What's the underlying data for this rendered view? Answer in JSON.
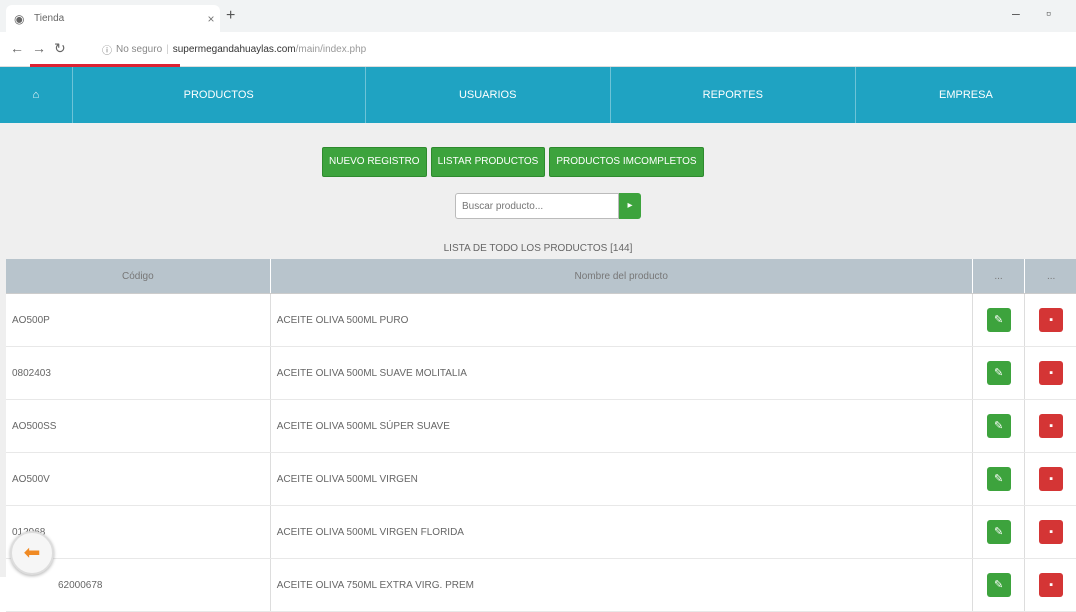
{
  "browser": {
    "tab_title": "Tienda",
    "tab_close": "×",
    "new_tab": "+",
    "url_security": "No seguro",
    "url_host": "supermegandahuaylas.com",
    "url_path": "/main/index.php"
  },
  "nav": {
    "home_icon": "⌂",
    "items": [
      "PRODUCTOS",
      "USUARIOS",
      "REPORTES",
      "EMPRESA"
    ]
  },
  "toolbar": {
    "new_label": "NUEVO REGISTRO",
    "list_label": "LISTAR PRODUCTOS",
    "incomplete_label": "PRODUCTOS IMCOMPLETOS"
  },
  "search": {
    "placeholder": "Buscar producto...",
    "go_label": "▸"
  },
  "list_title": "LISTA DE TODO LOS PRODUCTOS [144]",
  "table": {
    "headers": [
      "Código",
      "Nombre del producto",
      "...",
      "..."
    ],
    "rows": [
      {
        "code": "AO500P",
        "name": "ACEITE OLIVA 500ML PURO"
      },
      {
        "code": "0802403",
        "name": "ACEITE OLIVA 500ML SUAVE MOLITALIA"
      },
      {
        "code": "AO500SS",
        "name": "ACEITE OLIVA 500ML SÚPER SUAVE"
      },
      {
        "code": "AO500V",
        "name": "ACEITE OLIVA 500ML VIRGEN"
      },
      {
        "code": "012968",
        "name": "ACEITE OLIVA 500ML VIRGEN FLORIDA"
      },
      {
        "code": "62000678",
        "name": "ACEITE OLIVA 750ML EXTRA VIRG. PREM"
      }
    ]
  },
  "colors": {
    "nav_bg": "#1fa3c2",
    "green": "#3da33d",
    "red": "#d43535",
    "header_bg": "#b8c4cc"
  }
}
